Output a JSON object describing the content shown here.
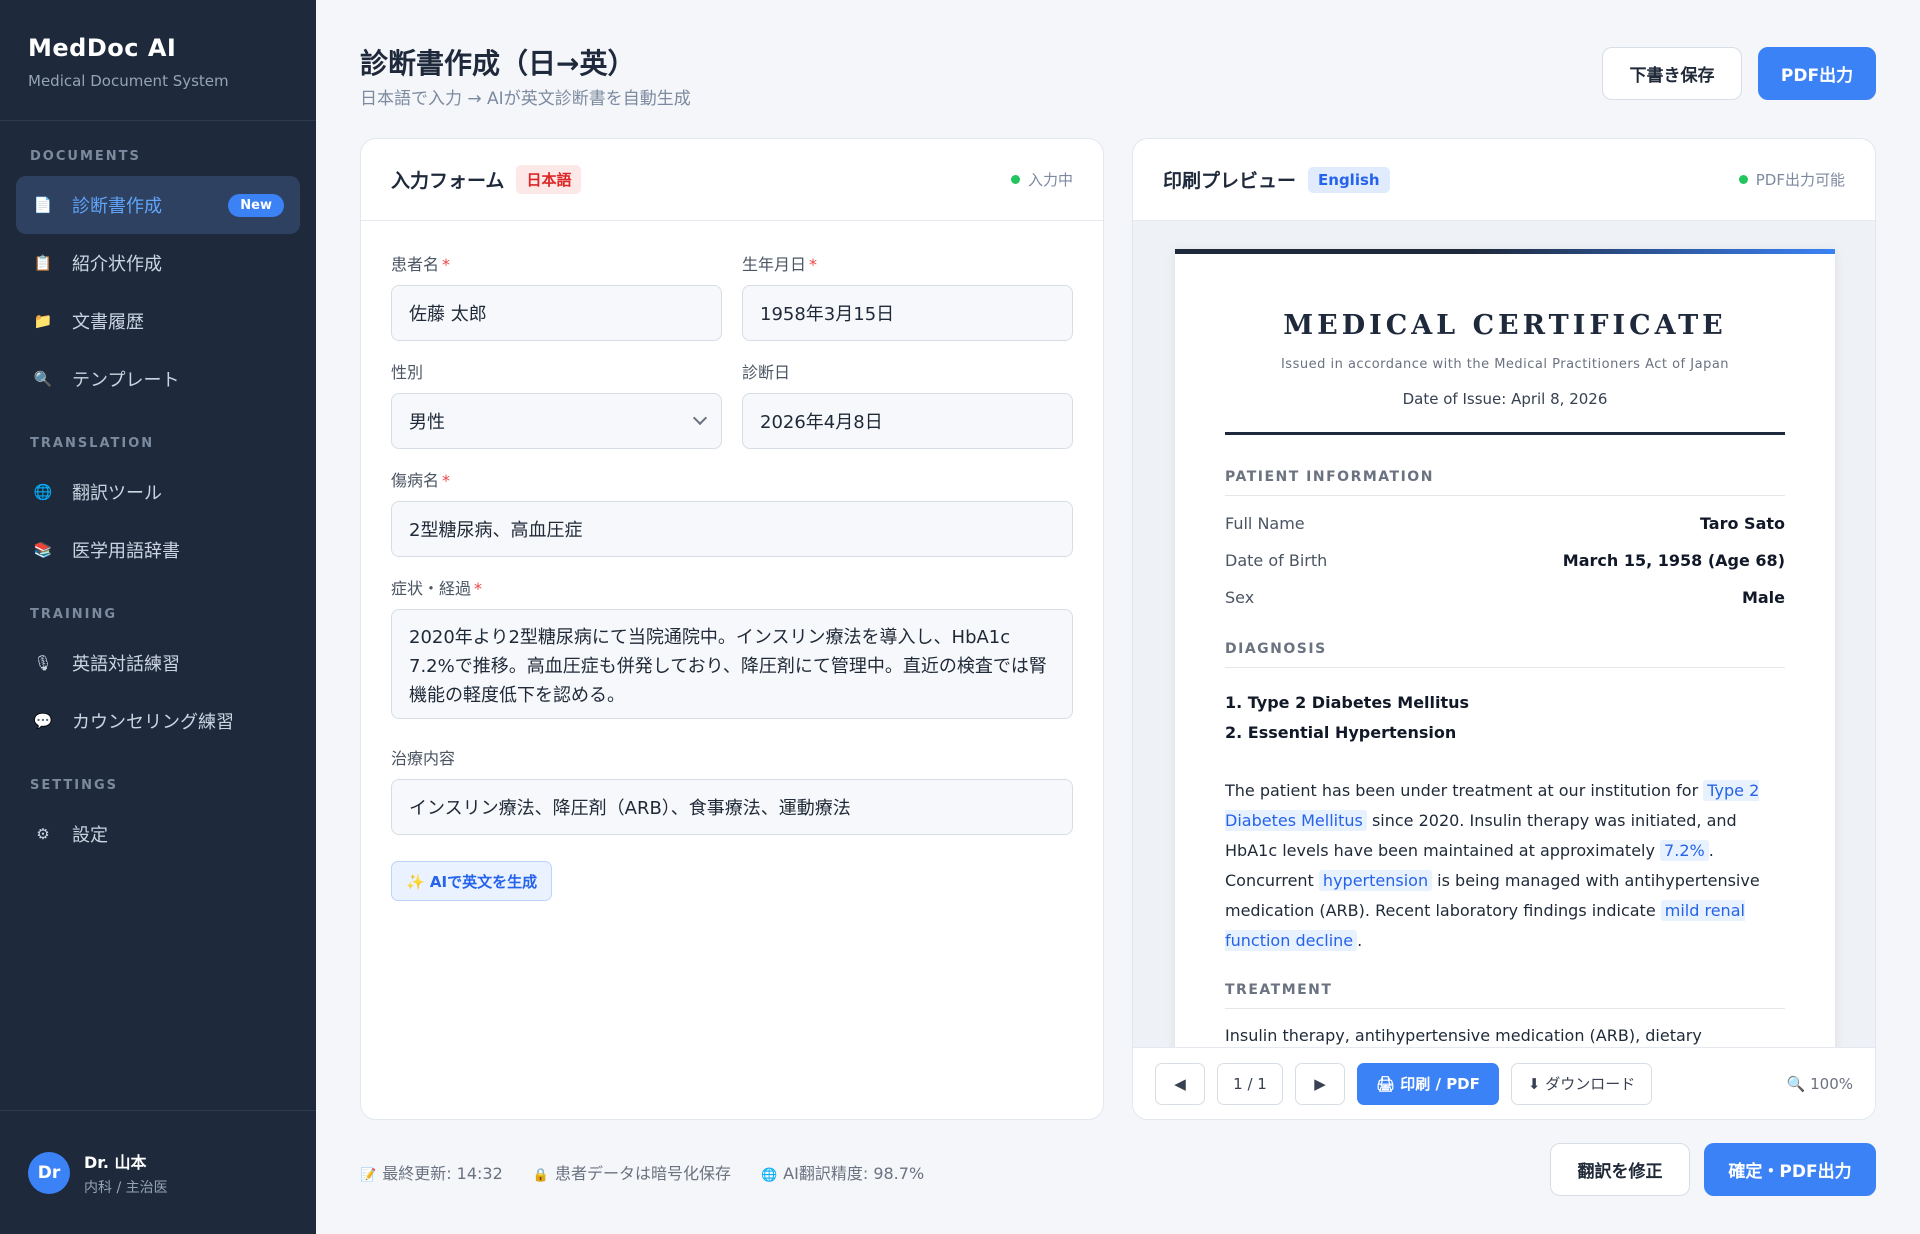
{
  "sidebar": {
    "brand": "MedDoc AI",
    "subtitle": "Medical Document System",
    "sections": {
      "documents": "DOCUMENTS",
      "translation": "TRANSLATION",
      "training": "TRAINING",
      "settings": "SETTINGS"
    },
    "items": {
      "create_cert": "診断書作成",
      "create_cert_badge": "New",
      "referral": "紹介状作成",
      "history": "文書履歴",
      "template": "テンプレート",
      "translate_tool": "翻訳ツール",
      "dictionary": "医学用語辞書",
      "conversation": "英語対話練習",
      "counseling": "カウンセリング練習",
      "settings": "設定"
    },
    "user": {
      "initials": "Dr",
      "name": "Dr. 山本",
      "role": "内科 / 主治医"
    }
  },
  "header": {
    "title": "診断書作成（日→英）",
    "subtitle": "日本語で入力 → AIが英文診断書を自動生成",
    "draft_label": "下書き保存",
    "pdf_label": "PDF出力"
  },
  "form": {
    "title": "入力フォーム",
    "lang": "日本語",
    "status": "入力中",
    "patient_name_label": "患者名",
    "patient_name": "佐藤 太郎",
    "dob_label": "生年月日",
    "dob": "1958年3月15日",
    "sex_label": "性別",
    "sex": "男性",
    "diag_date_label": "診断日",
    "diag_date": "2026年4月8日",
    "disease_label": "傷病名",
    "disease": "2型糖尿病、高血圧症",
    "symptoms_label": "症状・経過",
    "symptoms": "2020年より2型糖尿病にて当院通院中。インスリン療法を導入し、HbA1c 7.2%で推移。高血圧症も併発しており、降圧剤にて管理中。直近の検査では腎機能の軽度低下を認める。",
    "treatment_label": "治療内容",
    "treatment": "インスリン療法、降圧剤（ARB）、食事療法、運動療法",
    "ai_button": "✨ AIで英文を生成"
  },
  "preview": {
    "title": "印刷プレビュー",
    "lang": "English",
    "status": "PDF出力可能",
    "cert_title": "MEDICAL CERTIFICATE",
    "cert_sub": "Issued in accordance with the Medical Practitioners Act of Japan",
    "cert_date": "Date of Issue: April 8, 2026",
    "patient_section": "PATIENT INFORMATION",
    "full_name_k": "Full Name",
    "full_name_v": "Taro Sato",
    "dob_k": "Date of Birth",
    "dob_v": "March 15, 1958 (Age 68)",
    "sex_k": "Sex",
    "sex_v": "Male",
    "diagnosis_section": "DIAGNOSIS",
    "diag1": "1. Type 2 Diabetes Mellitus",
    "diag2": "2. Essential Hypertension",
    "p1": "The patient has been under treatment at our institution for",
    "h1": "Type 2 Diabetes Mellitus",
    "p2": "since 2020. Insulin therapy was initiated, and HbA1c levels have been maintained at approximately",
    "h2": "7.2%",
    "p3": ". Concurrent",
    "h3": "hypertension",
    "p4": "is being managed with antihypertensive medication (ARB). Recent laboratory findings indicate",
    "h4": "mild renal function decline",
    "p5": ".",
    "treatment_section": "TREATMENT",
    "treatment_text": "Insulin therapy, antihypertensive medication (ARB), dietary management, and exercise therapy.",
    "page": "1 / 1",
    "print_label": "🖨 印刷 / PDF",
    "download_label": "⬇ ダウンロード",
    "zoom": "🔍 100%"
  },
  "footer": {
    "updated": "最終更新: 14:32",
    "encrypted": "患者データは暗号化保存",
    "accuracy": "AI翻訳精度: 98.7%",
    "fix_label": "翻訳を修正",
    "confirm_label": "確定・PDF出力"
  }
}
